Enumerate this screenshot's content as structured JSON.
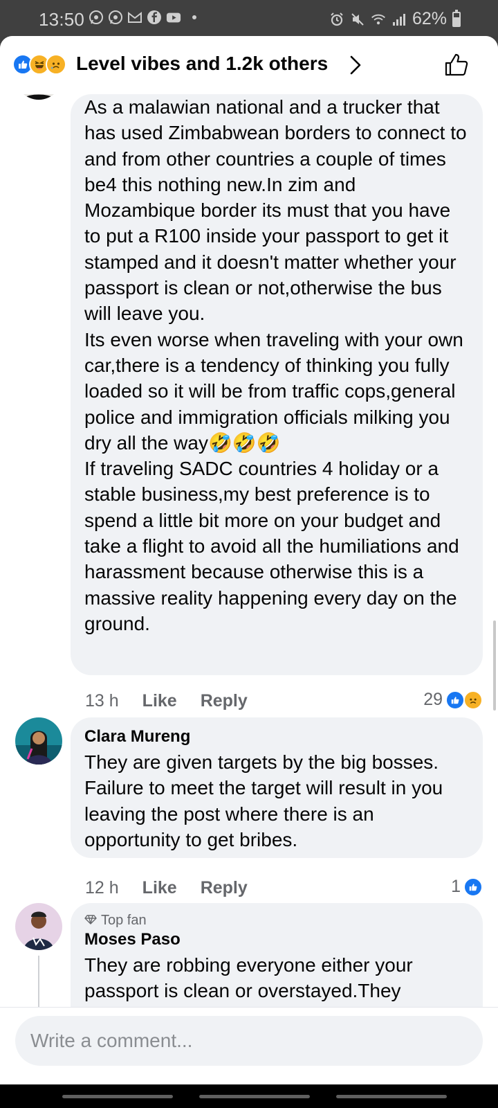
{
  "status_bar": {
    "time": "13:50",
    "battery": "62%",
    "battery_level": 0.62,
    "left_icons": [
      "whatsapp-icon",
      "whatsapp-icon",
      "gmail-icon",
      "facebook-icon",
      "youtube-icon"
    ],
    "right_icons": [
      "alarm-icon",
      "mute-icon",
      "wifi-icon",
      "signal-icon",
      "battery-icon"
    ]
  },
  "reactions_header": {
    "text": "Level vibes and 1.2k others",
    "reaction_icons": [
      "like",
      "haha",
      "sad"
    ]
  },
  "comments": [
    {
      "author": "",
      "text": "As a malawian national and a trucker that has used Zimbabwean borders to connect to and from other countries a couple of times be4 this nothing new.In zim and Mozambique border its must that you have to put a R100 inside your passport to get it stamped and it doesn't matter whether your passport is clean or not,otherwise the bus will leave you.\nIts even worse when traveling with your own car,there is a tendency of thinking you fully loaded so it will be from traffic cops,general police and immigration officials milking you dry all the way🤣🤣🤣\nIf traveling SADC countries 4 holiday or a stable business,my best preference is to spend a little bit more on your budget and take a flight to avoid all the humiliations and harassment because otherwise this is a massive reality happening every day on the ground.",
      "time": "13 h",
      "like_label": "Like",
      "reply_label": "Reply",
      "reaction_count": "29",
      "reactions": [
        "like",
        "sad"
      ]
    },
    {
      "author": "Clara Mureng",
      "text": "They are given targets by the big bosses. Failure to meet the target will result in you leaving the post where there is an opportunity to get bribes.",
      "time": "12 h",
      "like_label": "Like",
      "reply_label": "Reply",
      "reaction_count": "1",
      "reactions": [
        "like"
      ]
    },
    {
      "badge": "Top fan",
      "author": "Moses Paso",
      "text": "They are robbing everyone either your passport is clean or overstayed.They"
    }
  ],
  "composer": {
    "placeholder": "Write a comment..."
  },
  "colors": {
    "accent": "#1877f2",
    "bubble": "#f0f2f5",
    "secondary_text": "#65676b",
    "status_bar": "#404040"
  }
}
